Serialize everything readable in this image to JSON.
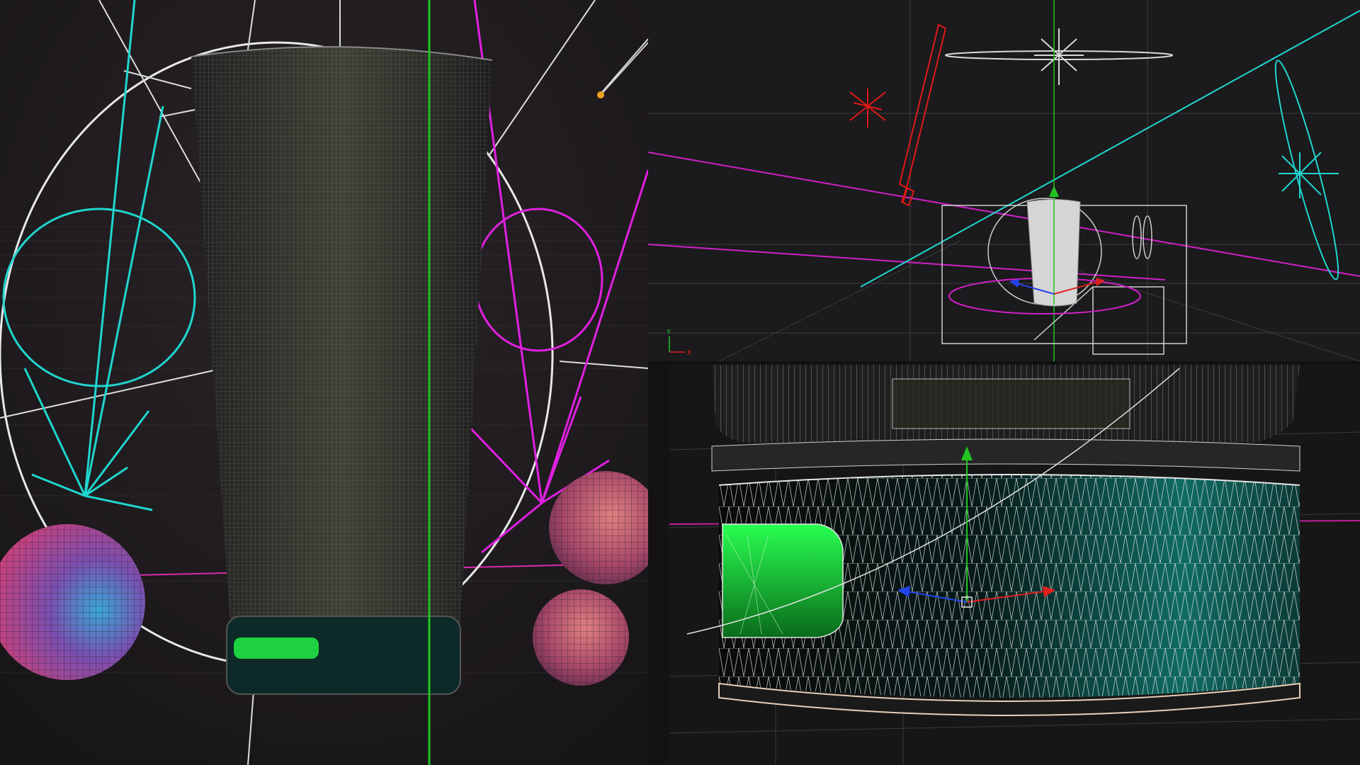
{
  "viewports": [
    {
      "id": "perspective-close",
      "view": "perspective"
    },
    {
      "id": "perspective-wide",
      "view": "perspective"
    },
    {
      "id": "perspective-base",
      "view": "perspective"
    }
  ],
  "axis_gizmo": {
    "y_label": "Y",
    "x_label": "X"
  },
  "colors": {
    "light_cyan": "#1fd6cf",
    "light_magenta": "#e020e0",
    "light_red": "#e01818",
    "wire_white": "#e6e6e6",
    "grid_green": "#22c422",
    "led_green": "#22ee44",
    "base_teal": "#0f6b63"
  }
}
